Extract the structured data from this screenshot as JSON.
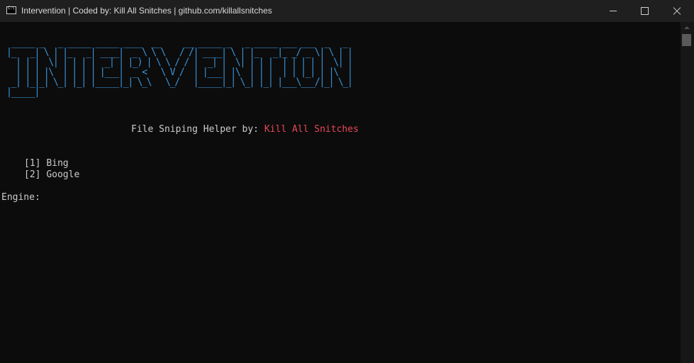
{
  "window": {
    "title": "Intervention | Coded by: Kill All Snitches | github.com/killallsnitches"
  },
  "console": {
    "banner_lines": [
      " _____ _   _ _____ _____ ____  __     __ _____ _   _ _____ ___ ___  _   _ ",
      "|_   _| \\ | |_   _| ____|  _ \\ \\ \\   / /| ____| \\ | |_   _|_ _/ _ \\| \\ | |",
      "  | | |  \\| | | | |  _| | |_) | \\ \\ / / |  _| |  \\| | | |  | | | | |  \\| |",
      "  | | | |\\  | | | | |___|  _ <   \\ V /  | |___| |\\  | | |  | | |_| | |\\  |",
      " _| |_|_| \\_| |_| |_____|_| \\_\\   \\_/   |_____|_| \\_| |_| |___\\___/|_| \\_|",
      "|_____|                                                                    "
    ],
    "subtitle": "File Sniping Helper by: ",
    "author": "Kill All Snitches",
    "menu": [
      {
        "key": "[1]",
        "label": "Bing"
      },
      {
        "key": "[2]",
        "label": "Google"
      }
    ],
    "prompt": "Engine:"
  },
  "colors": {
    "background": "#0c0c0c",
    "titlebar": "#1f1f1f",
    "banner": "#3a96dd",
    "text": "#cccccc",
    "author": "#e74856"
  }
}
